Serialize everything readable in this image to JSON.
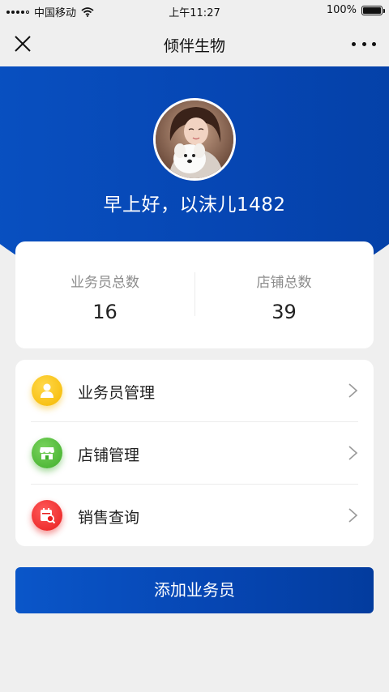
{
  "status_bar": {
    "carrier": "中国移动",
    "time": "上午11:27",
    "battery_percent": "100%",
    "battery_level": 1.0,
    "signal_bars": 4,
    "wifi_icon": "wifi-icon"
  },
  "nav": {
    "title": "倾伴生物",
    "close_icon": "close-icon",
    "more_icon": "more-icon"
  },
  "profile": {
    "greeting": "早上好，以沫儿1482",
    "avatar": "avatar-photo"
  },
  "stats": [
    {
      "label": "业务员总数",
      "value": "16"
    },
    {
      "label": "店铺总数",
      "value": "39"
    }
  ],
  "menu": [
    {
      "label": "业务员管理",
      "icon": "user-icon",
      "color": "#f5b800"
    },
    {
      "label": "店铺管理",
      "icon": "store-icon",
      "color": "#3fae2a"
    },
    {
      "label": "销售查询",
      "icon": "calendar-search-icon",
      "color": "#e81d1d"
    }
  ],
  "actions": {
    "add_salesperson": "添加业务员"
  },
  "colors": {
    "primary": "#0646b3",
    "background": "#efefef"
  }
}
